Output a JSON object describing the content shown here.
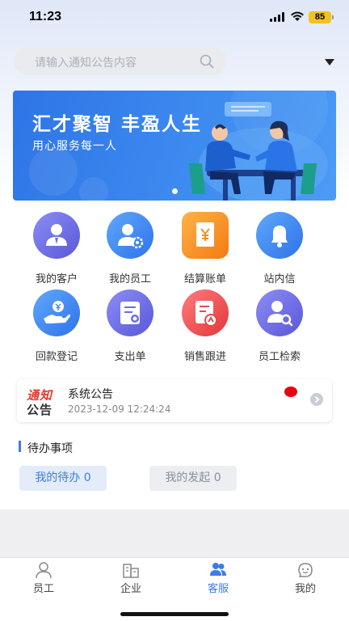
{
  "status_bar": {
    "time": "11:23",
    "battery": "85",
    "icons": [
      "signal-icon",
      "wifi-icon",
      "battery-icon"
    ]
  },
  "search": {
    "placeholder": "请输入通知公告内容",
    "icon": "search-icon"
  },
  "banner": {
    "title": "汇才聚智 丰盈人生",
    "subtitle": "用心服务每一人"
  },
  "grid": {
    "items": [
      {
        "label": "我的客户",
        "icon": "customer-icon",
        "color": "#6b6cee"
      },
      {
        "label": "我的员工",
        "icon": "employee-gear-icon",
        "color": "#3d84f0"
      },
      {
        "label": "结算账单",
        "icon": "bill-yen-icon",
        "color": "#f5901e"
      },
      {
        "label": "站内信",
        "icon": "bell-icon",
        "color": "#3d84f0"
      },
      {
        "label": "回款登记",
        "icon": "payment-hand-icon",
        "color": "#3d84f0"
      },
      {
        "label": "支出单",
        "icon": "expense-form-icon",
        "color": "#6b6cee"
      },
      {
        "label": "销售跟进",
        "icon": "sales-chart-icon",
        "color": "#e8484a"
      },
      {
        "label": "员工检索",
        "icon": "employee-search-icon",
        "color": "#6b6cee"
      }
    ]
  },
  "notice": {
    "logo_top": "通知",
    "logo_bottom": "公告",
    "title": "系统公告",
    "time": "2023-12-09 12:24:24",
    "unread_color": "#e60012"
  },
  "todo": {
    "title": "待办事项",
    "mine": "我的待办 0",
    "launched": "我的发起 0"
  },
  "tabs": [
    {
      "label": "员工",
      "icon": "person-icon",
      "active": false
    },
    {
      "label": "企业",
      "icon": "building-icon",
      "active": false
    },
    {
      "label": "客服",
      "icon": "service-people-icon",
      "active": true
    },
    {
      "label": "我的",
      "icon": "smiley-face-icon",
      "active": false
    }
  ],
  "colors": {
    "accent": "#3e7bea",
    "banner": "#3d8af0"
  }
}
